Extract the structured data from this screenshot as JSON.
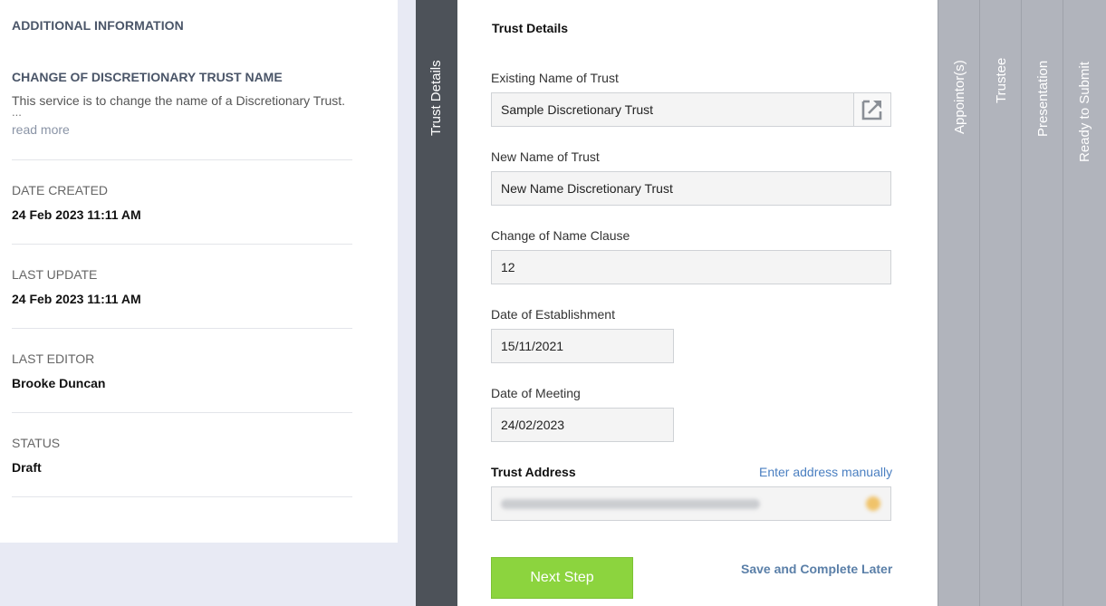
{
  "info": {
    "heading": "ADDITIONAL INFORMATION",
    "service_title": "CHANGE OF DISCRETIONARY TRUST NAME",
    "service_desc": "This service is to change the name of a Discretionary Trust.",
    "ellipsis": "...",
    "read_more": "read more",
    "meta": [
      {
        "label": "DATE CREATED",
        "value": "24 Feb 2023 11:11 AM"
      },
      {
        "label": "LAST UPDATE",
        "value": "24 Feb 2023 11:11 AM"
      },
      {
        "label": "LAST EDITOR",
        "value": "Brooke Duncan"
      },
      {
        "label": "STATUS",
        "value": "Draft"
      }
    ]
  },
  "steps": {
    "active": "Trust Details",
    "others": [
      "Appointor(s)",
      "Trustee",
      "Presentation",
      "Ready to Submit"
    ]
  },
  "form": {
    "title": "Trust Details",
    "existing_name": {
      "label": "Existing Name of Trust",
      "value": "Sample Discretionary Trust"
    },
    "new_name": {
      "label": "New Name of Trust",
      "value": "New Name Discretionary Trust"
    },
    "clause": {
      "label": "Change of Name Clause",
      "value": "12"
    },
    "establishment": {
      "label": "Date of Establishment",
      "value": "15/11/2021"
    },
    "meeting": {
      "label": "Date of Meeting",
      "value": "24/02/2023"
    },
    "address": {
      "label": "Trust Address",
      "manual_link": "Enter address manually"
    },
    "next_button": "Next Step",
    "save_later": "Save and Complete Later"
  },
  "colors": {
    "active_step": "#4d5259",
    "inactive_step": "#b1b4bc",
    "primary_button": "#8cd43e",
    "link": "#4a7fc1"
  },
  "icons": {
    "open_external": "open-external-icon"
  }
}
